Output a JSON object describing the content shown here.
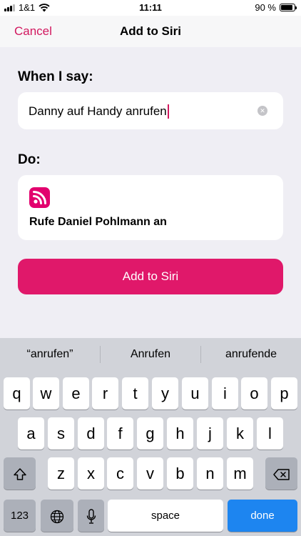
{
  "status_bar": {
    "carrier": "1&1",
    "time": "11:11",
    "battery_text": "90 %",
    "battery_level": 0.9
  },
  "nav": {
    "cancel_label": "Cancel",
    "title": "Add to Siri"
  },
  "phrase": {
    "label": "When I say:",
    "value": "Danny auf Handy anrufen"
  },
  "action": {
    "label": "Do:",
    "app_icon": "rss-feed-icon",
    "text": "Rufe Daniel Pohlmann an"
  },
  "add_button_label": "Add to Siri",
  "keyboard": {
    "suggestions": [
      "“anrufen”",
      "Anrufen",
      "anrufende"
    ],
    "row1": [
      "q",
      "w",
      "e",
      "r",
      "t",
      "y",
      "u",
      "i",
      "o",
      "p"
    ],
    "row2": [
      "a",
      "s",
      "d",
      "f",
      "g",
      "h",
      "j",
      "k",
      "l"
    ],
    "row3": [
      "z",
      "x",
      "c",
      "v",
      "b",
      "n",
      "m"
    ],
    "numbers_label": "123",
    "space_label": "space",
    "done_label": "done"
  },
  "colors": {
    "accent": "#d2185f",
    "button": "#e0186a",
    "done": "#1d85f0"
  }
}
